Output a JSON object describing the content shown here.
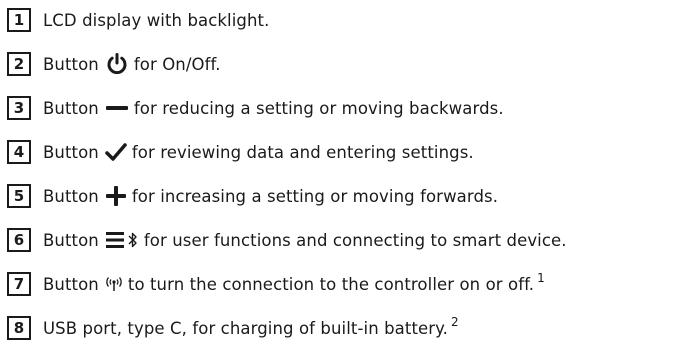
{
  "items": [
    {
      "number": "1",
      "before": "LCD display with backlight.",
      "icon": "",
      "after": "",
      "sup": ""
    },
    {
      "number": "2",
      "before": "Button",
      "icon": "power-icon",
      "after": "for On/Off.",
      "sup": ""
    },
    {
      "number": "3",
      "before": "Button",
      "icon": "minus-icon",
      "after": "for reducing a setting or moving backwards.",
      "sup": ""
    },
    {
      "number": "4",
      "before": "Button",
      "icon": "check-icon",
      "after": "for reviewing data and entering settings.",
      "sup": ""
    },
    {
      "number": "5",
      "before": "Button",
      "icon": "plus-icon",
      "after": "for increasing a setting or moving forwards.",
      "sup": ""
    },
    {
      "number": "6",
      "before": "Button",
      "icon": "menu-bluetooth-icon",
      "after": "for user functions and connecting to smart device.",
      "sup": ""
    },
    {
      "number": "7",
      "before": "Button",
      "icon": "wireless-icon",
      "after": "to turn the connection to the controller on or off.",
      "sup": "1"
    },
    {
      "number": "8",
      "before": "USB port, type C, for charging of built-in battery.",
      "icon": "",
      "after": "",
      "sup": "2"
    }
  ],
  "colors": {
    "text": "#1a1a1a",
    "border": "#1a1a1a"
  }
}
